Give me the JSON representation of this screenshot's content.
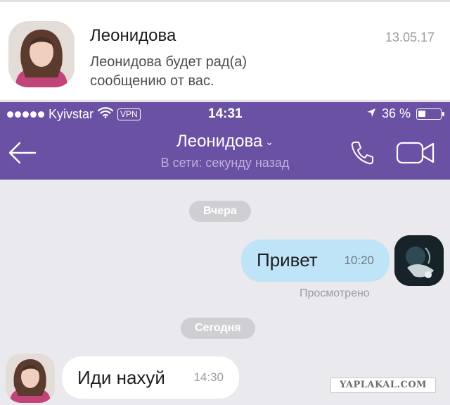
{
  "notification": {
    "name": "Леонидова",
    "date": "13.05.17",
    "message": "Леонидова будет рад(а) сообщению от вас.",
    "avatar_icon": "profile-photo"
  },
  "status_bar": {
    "carrier": "Kyivstar",
    "vpn": "VPN",
    "time": "14:31",
    "battery": "36 %",
    "battery_level": 0.36
  },
  "nav": {
    "back_icon": "back-arrow-icon",
    "title": "Леонидова",
    "subtitle": "В сети: секунду назад",
    "call_icon": "phone-icon",
    "video_icon": "video-camera-icon"
  },
  "chat": {
    "sections": [
      {
        "label": "Вчера"
      },
      {
        "label": "Сегодня"
      }
    ],
    "outgoing": {
      "text": "Привет",
      "time": "10:20",
      "status": "Просмотрено"
    },
    "incoming": {
      "text": "Иди нахуй",
      "time": "14:30"
    }
  },
  "watermark": "YAPLAKAL.COM",
  "colors": {
    "accent": "#6a51a4",
    "outgoing_bubble": "#bfe3f7",
    "incoming_bubble": "#ffffff",
    "chat_background": "#e9e9ee"
  }
}
